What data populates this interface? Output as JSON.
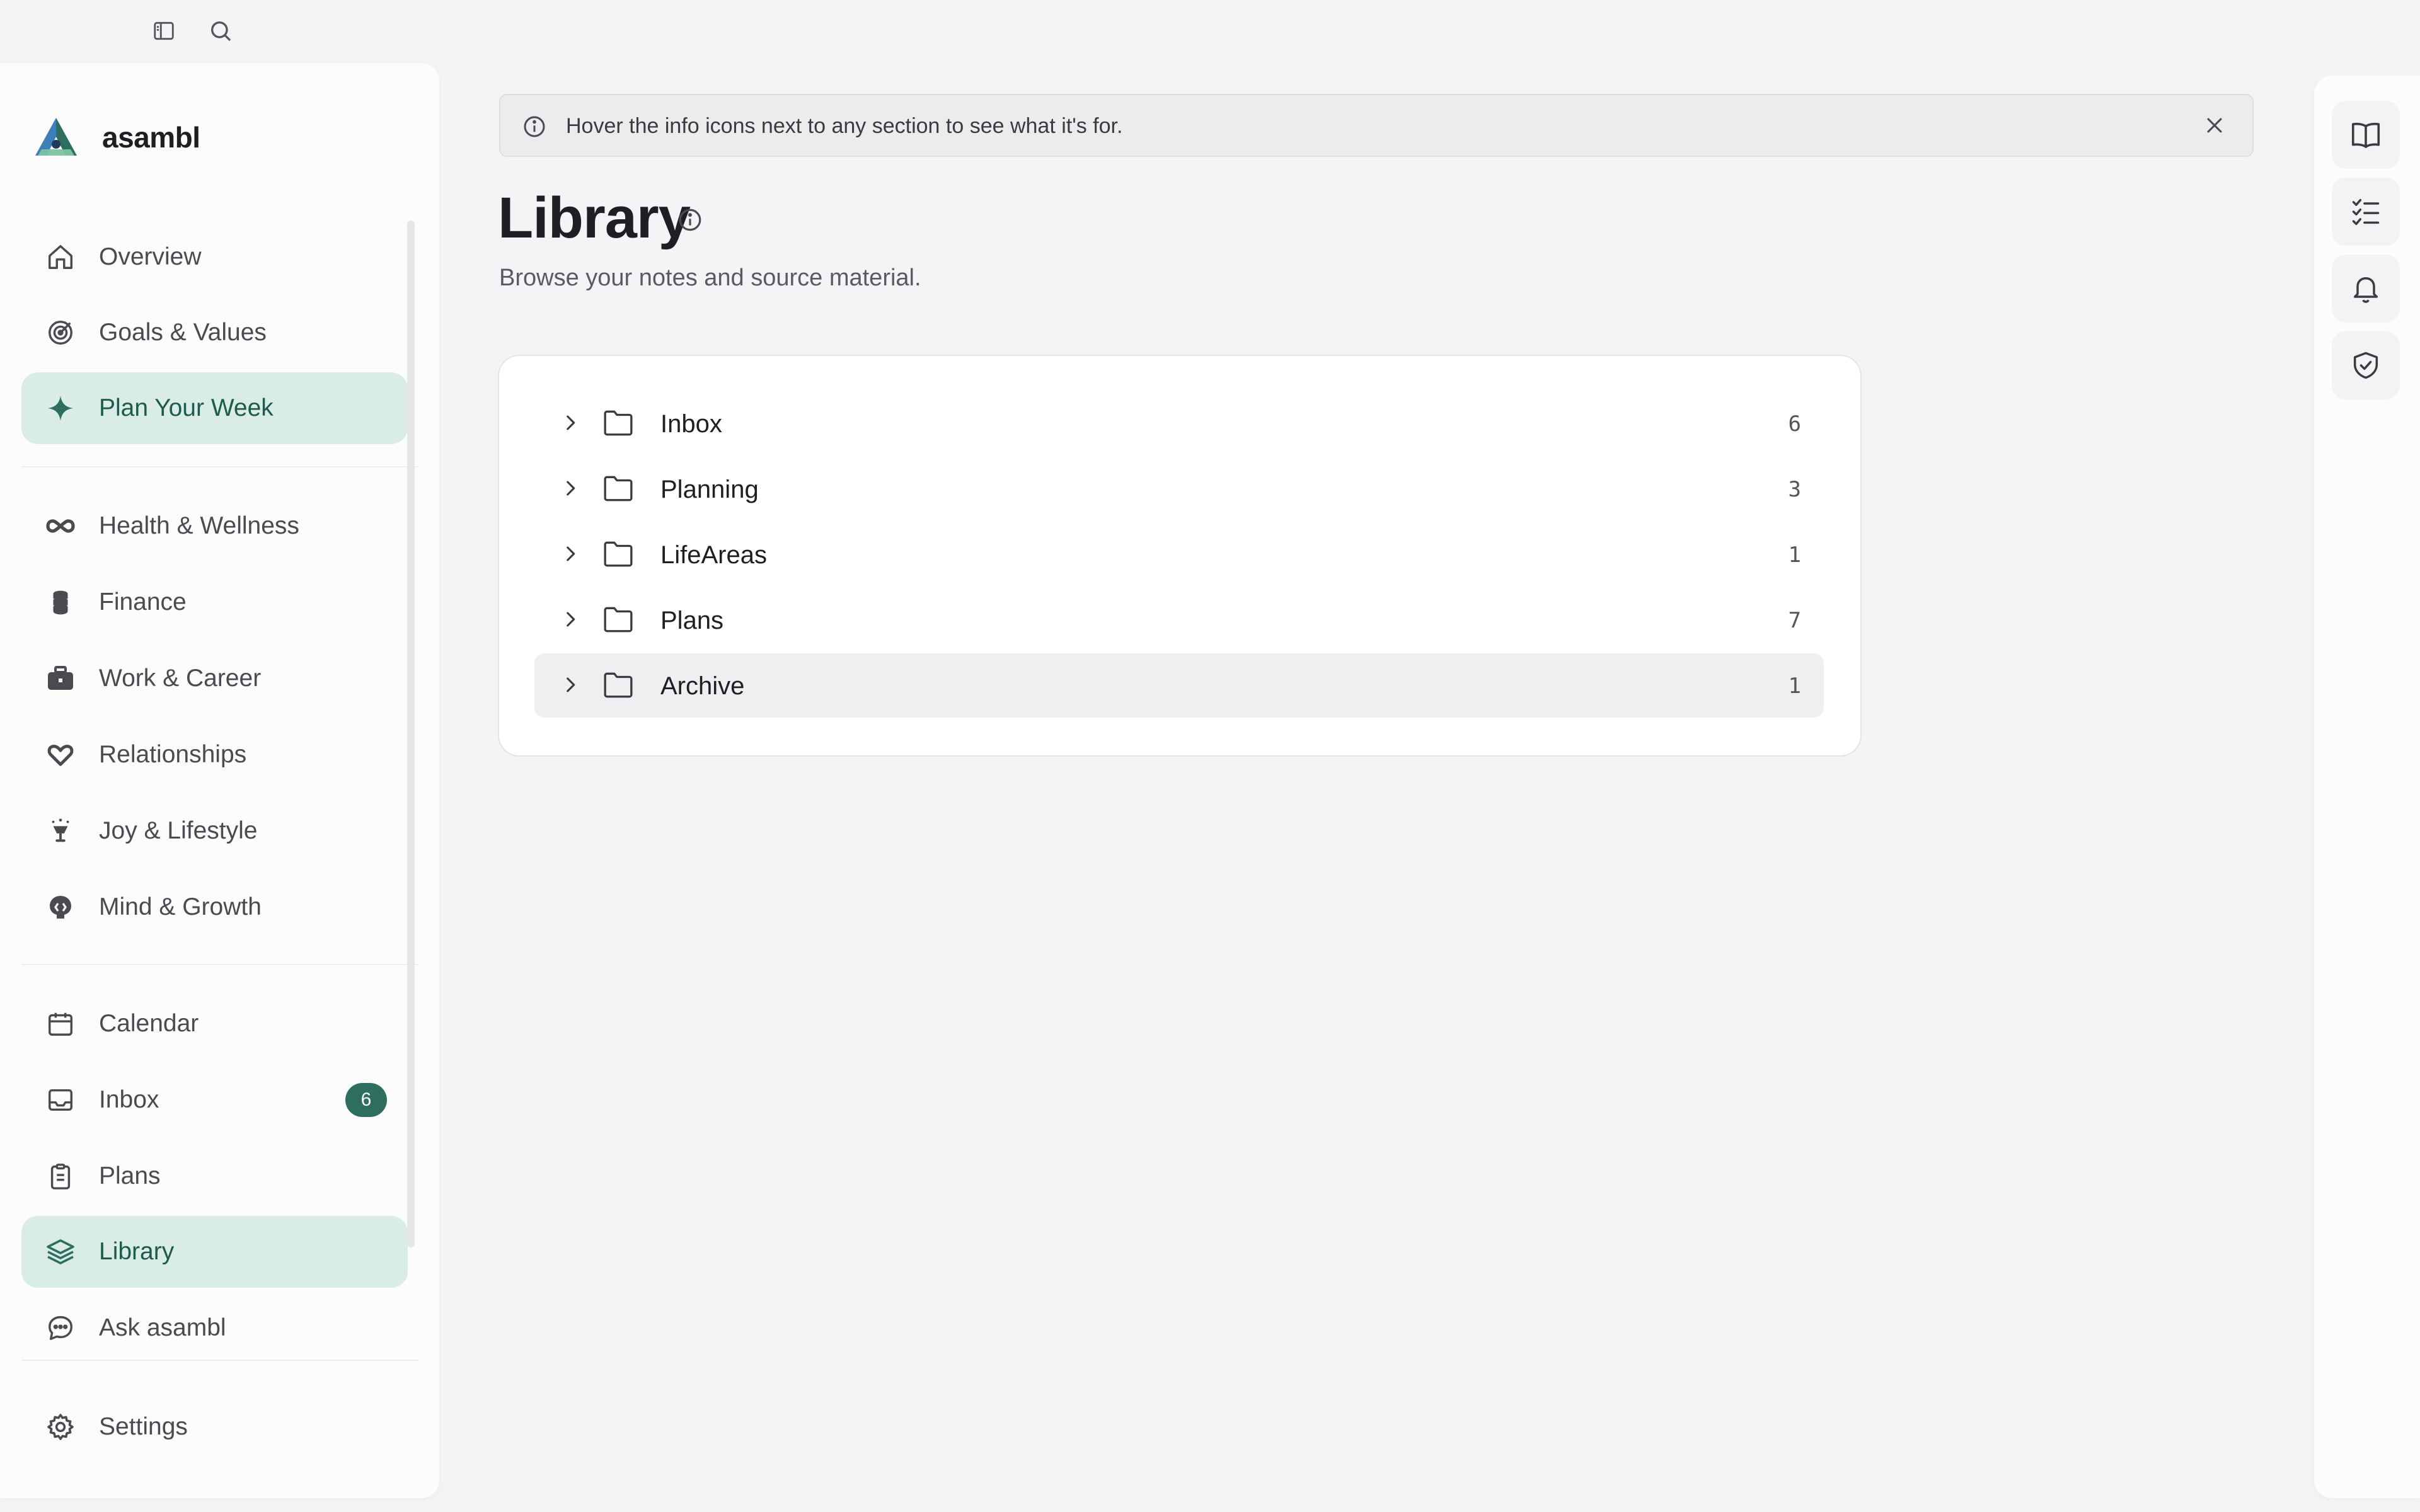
{
  "brand": {
    "name": "asambl"
  },
  "sidebar": {
    "items_primary": [
      {
        "label": "Overview",
        "icon": "home-icon"
      },
      {
        "label": "Goals & Values",
        "icon": "target-icon"
      },
      {
        "label": "Plan Your Week",
        "icon": "sparkle-icon",
        "active": true
      }
    ],
    "items_areas": [
      {
        "label": "Health & Wellness",
        "icon": "infinity-icon"
      },
      {
        "label": "Finance",
        "icon": "coins-icon"
      },
      {
        "label": "Work & Career",
        "icon": "briefcase-icon"
      },
      {
        "label": "Relationships",
        "icon": "heart-icon"
      },
      {
        "label": "Joy & Lifestyle",
        "icon": "glass-icon"
      },
      {
        "label": "Mind & Growth",
        "icon": "brain-icon"
      }
    ],
    "items_tools": [
      {
        "label": "Calendar",
        "icon": "calendar-icon"
      },
      {
        "label": "Inbox",
        "icon": "inbox-icon",
        "badge": "6"
      },
      {
        "label": "Plans",
        "icon": "clipboard-icon"
      },
      {
        "label": "Library",
        "icon": "layers-icon",
        "active": true
      },
      {
        "label": "Ask asambl",
        "icon": "chat-icon"
      }
    ],
    "settings": {
      "label": "Settings",
      "icon": "gear-icon"
    }
  },
  "banner": {
    "text": "Hover the info icons next to any section to see what it's for."
  },
  "page": {
    "title": "Library",
    "subtitle": "Browse your notes and source material."
  },
  "folders": [
    {
      "name": "Inbox",
      "count": "6"
    },
    {
      "name": "Planning",
      "count": "3"
    },
    {
      "name": "LifeAreas",
      "count": "1"
    },
    {
      "name": "Plans",
      "count": "7"
    },
    {
      "name": "Archive",
      "count": "1"
    }
  ],
  "rail": [
    "book-icon",
    "checklist-icon",
    "bell-icon",
    "shield-check-icon"
  ],
  "colors": {
    "accent": "#2e6e5e",
    "active_bg": "#d9ede6",
    "background": "#f4f4f6"
  }
}
